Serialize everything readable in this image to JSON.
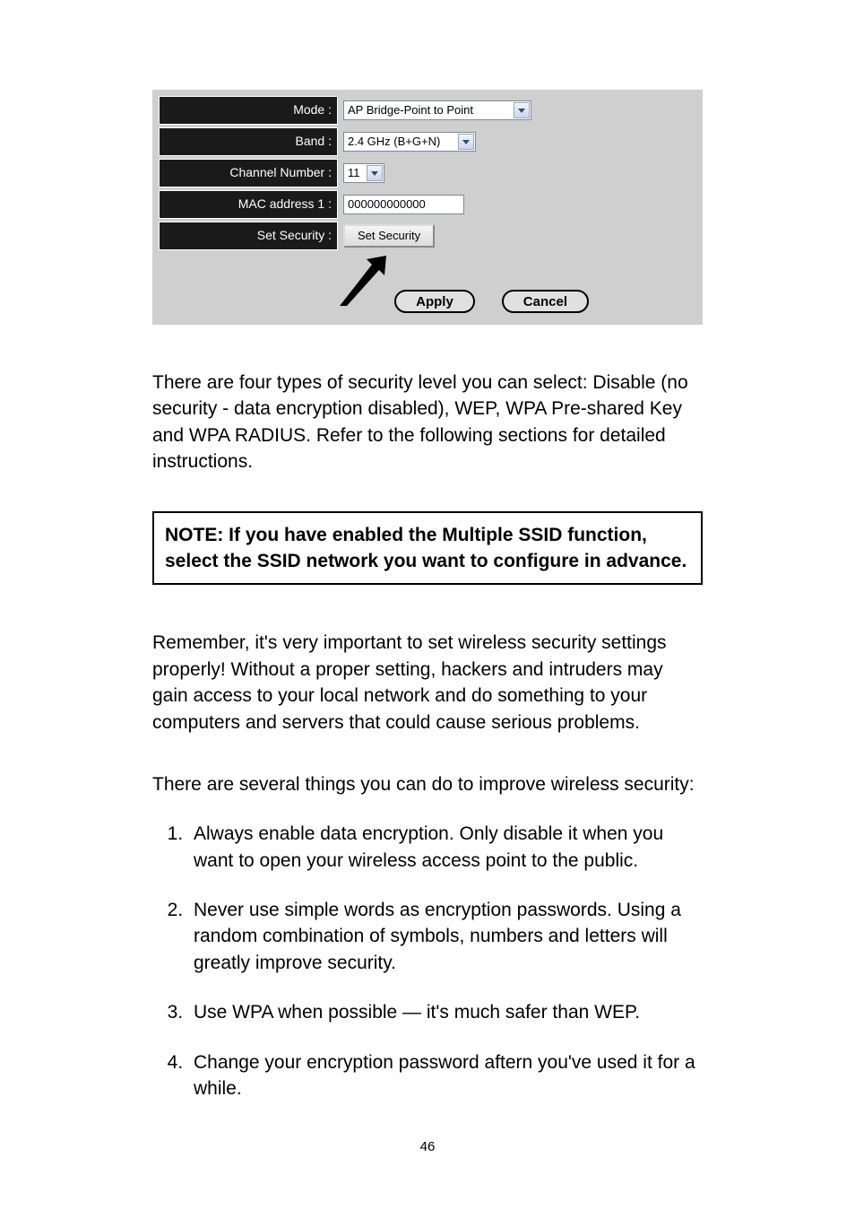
{
  "config": {
    "mode": {
      "label": "Mode :",
      "value": "AP Bridge-Point to Point"
    },
    "band": {
      "label": "Band :",
      "value": "2.4 GHz (B+G+N)"
    },
    "channel": {
      "label": "Channel Number :",
      "value": "11"
    },
    "mac1": {
      "label": "MAC address 1 :",
      "value": "000000000000"
    },
    "security": {
      "label": "Set Security :",
      "button": "Set Security"
    },
    "apply": "Apply",
    "cancel": "Cancel"
  },
  "para1": "There are four types of security level you can select: Disable (no security - data encryption disabled), WEP, WPA Pre-shared Key and WPA RADIUS. Refer to the following sections for detailed instructions.",
  "note": "NOTE: If you have enabled the Multiple SSID function, select the SSID network you want to configure in advance.",
  "para2": "Remember, it's very important to set wireless security settings properly! Without a proper setting, hackers and intruders may gain access to your local network and do something to your computers and servers that could cause serious problems.",
  "para3": "There are several things you can do to improve wireless security:",
  "tips": [
    "Always enable data encryption. Only disable it when you want to open your wireless access point to the public.",
    "Never use simple words as encryption passwords. Using a random combination of symbols, numbers and letters will greatly improve security.",
    "Use WPA when possible — it's much safer than WEP.",
    "Change your encryption password aftern you've used it for a while."
  ],
  "page_number": "46"
}
